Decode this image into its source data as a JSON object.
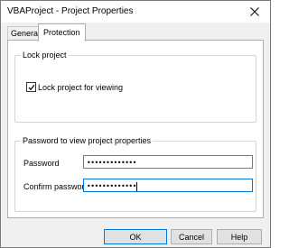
{
  "window": {
    "title": "VBAProject - Project Properties",
    "close_symbol": "✕"
  },
  "tabs": [
    {
      "label": "General",
      "active": false
    },
    {
      "label": "Protection",
      "active": true
    }
  ],
  "lock_group": {
    "legend": "Lock project",
    "checkbox_label": "Lock project for viewing",
    "checked": true
  },
  "password_group": {
    "legend": "Password to view project properties",
    "password_label": "Password",
    "password_value": "•••••••••••••",
    "confirm_label": "Confirm password",
    "confirm_value": "•••••••••••••"
  },
  "buttons": {
    "ok": "OK",
    "cancel": "Cancel",
    "help": "Help"
  },
  "colors": {
    "accent": "#0078d7",
    "dialog_bg": "#f0f0f0"
  }
}
